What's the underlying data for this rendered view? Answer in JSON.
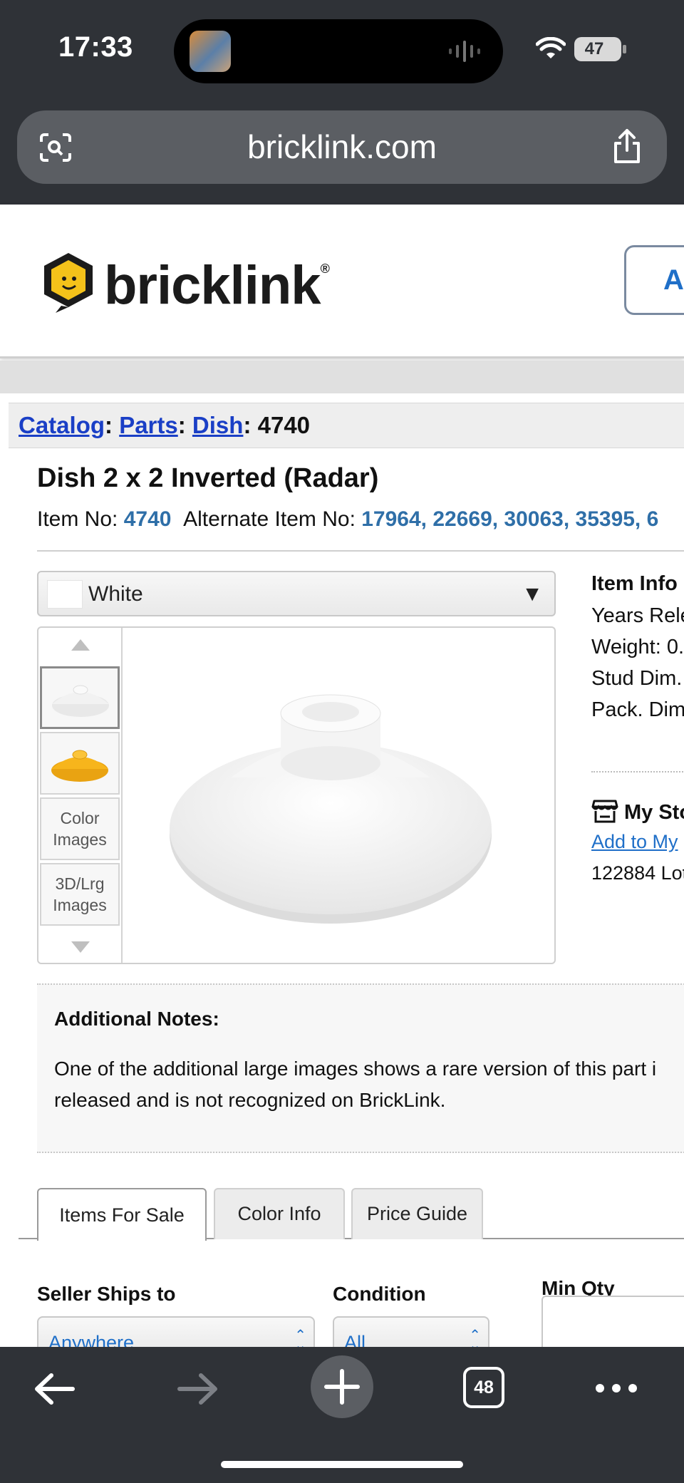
{
  "status_bar": {
    "time": "17:33",
    "battery": "47"
  },
  "browser": {
    "url": "bricklink.com",
    "tab_count": "48"
  },
  "header": {
    "logo_text": "bricklink",
    "logo_reg": "®",
    "button_partial": "Al"
  },
  "breadcrumb": {
    "catalog": "Catalog",
    "parts": "Parts",
    "dish": "Dish",
    "sep": ": ",
    "item": "4740"
  },
  "item": {
    "title": "Dish 2 x 2 Inverted (Radar)",
    "item_no_label": "Item No: ",
    "item_no": "4740",
    "alt_label": "Alternate Item No: ",
    "alt_values": "17964, 22669, 30063, 35395, 6"
  },
  "color_select": {
    "value": "White",
    "arrow": "▼"
  },
  "viewer": {
    "thumb_color_images": "Color Images",
    "thumb_3d_images": "3D/Lrg Images"
  },
  "item_info": {
    "heading": "Item Info",
    "lines": [
      "Years Rele",
      "Weight: 0.",
      "Stud Dim.",
      "Pack. Dim"
    ]
  },
  "my_store": {
    "heading": "My Sto",
    "link": "Add to My ",
    "lots": "122884 Lot"
  },
  "notes": {
    "heading": "Additional Notes:",
    "line1": "One of the additional large images shows a rare version of this part i",
    "line2": "released and is not recognized on BrickLink."
  },
  "tabs": [
    "Items For Sale",
    "Color Info",
    "Price Guide"
  ],
  "filters": {
    "ships_label": "Seller Ships to",
    "ships_value": "Anywhere",
    "condition_label": "Condition",
    "condition_value": "All",
    "minqty_label": "Min Qty"
  },
  "colors": {
    "chrome": "#2f3237",
    "link_blue": "#1a3fc6",
    "item_blue": "#2f6fa8",
    "accent": "#1f6fc8"
  }
}
